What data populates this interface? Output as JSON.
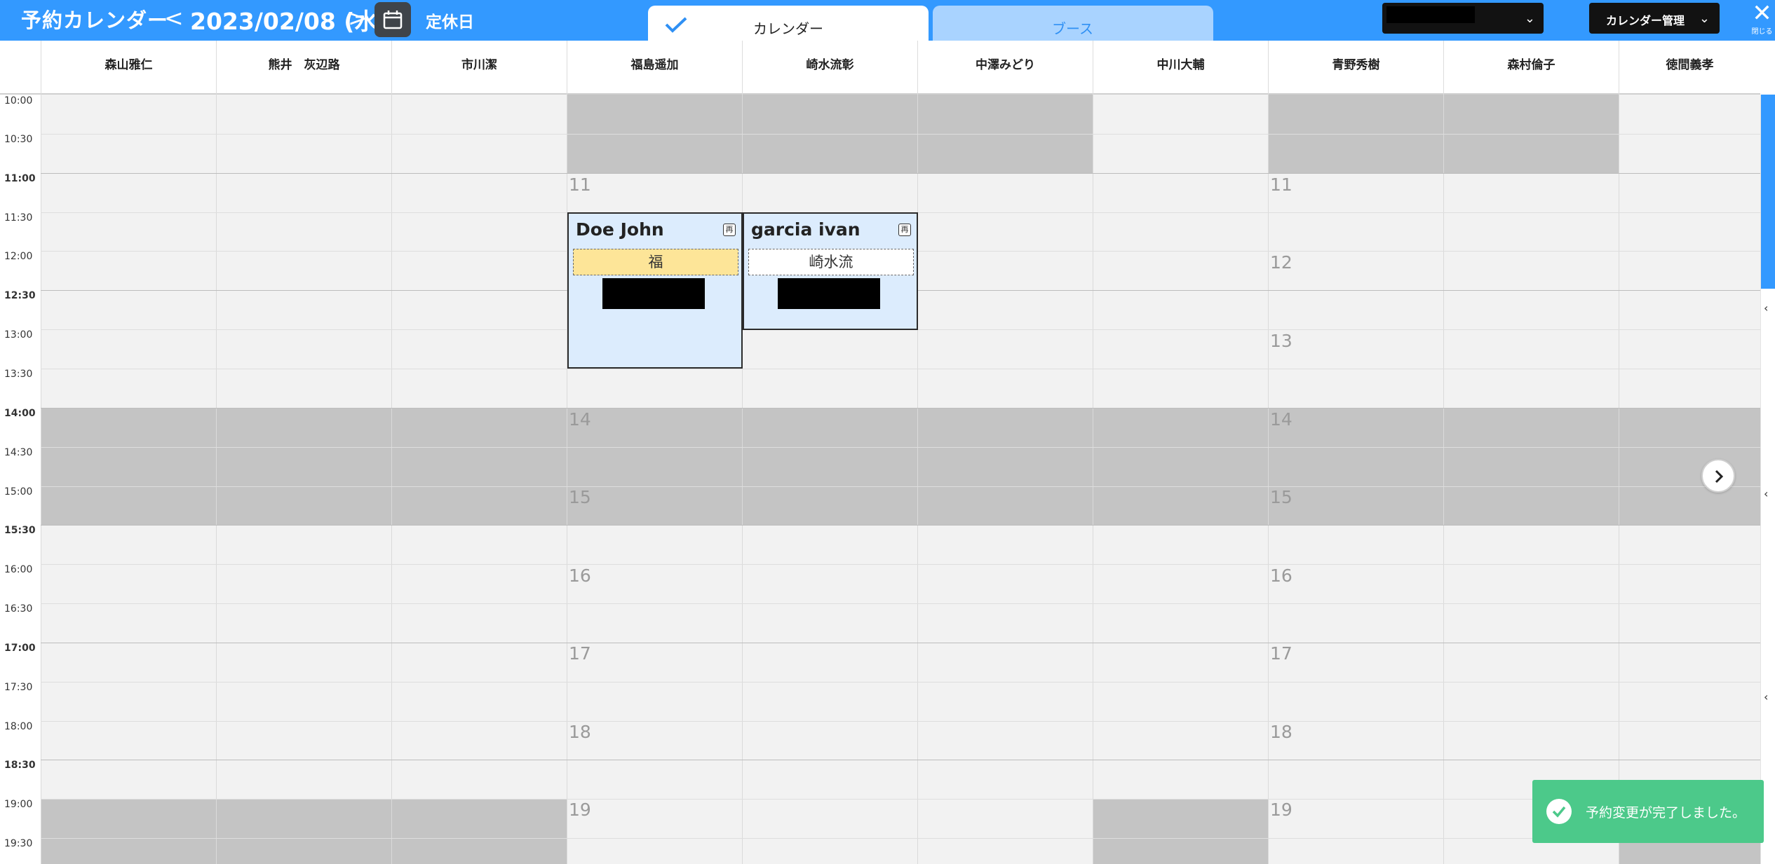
{
  "header": {
    "app_title": "予約カレンダー",
    "date_text": "2023/02/08 (水)",
    "prev_symbol": "<",
    "next_symbol": ">",
    "holiday_label": "定休日",
    "tabs": [
      {
        "label": "カレンダー",
        "active": true
      },
      {
        "label": "ブース",
        "active": false
      }
    ],
    "calendar_manage_label": "カレンダー管理",
    "close_label": "閉じる",
    "colors": {
      "primary": "#3399ff",
      "tab_inactive": "#a9d3ff",
      "dark_button": "#121212"
    }
  },
  "staff_columns": [
    "森山雅仁",
    "熊井　灰辺路",
    "市川潔",
    "福島遥加",
    "崎水流彰",
    "中澤みどり",
    "中川大輔",
    "青野秀樹",
    "森村倫子",
    "徳間義孝"
  ],
  "time_slots": [
    "10:00",
    "10:30",
    "11:00",
    "11:30",
    "12:00",
    "12:30",
    "13:00",
    "13:30",
    "14:00",
    "14:30",
    "15:00",
    "15:30",
    "16:00",
    "16:30",
    "17:00",
    "17:30",
    "18:00",
    "18:30",
    "19:00",
    "19:30"
  ],
  "hour_markers": {
    "col_4": [
      "11",
      "14",
      "15",
      "16",
      "17",
      "18",
      "19"
    ],
    "col_8": [
      "11",
      "12",
      "13",
      "14",
      "15",
      "16",
      "17",
      "18",
      "19"
    ]
  },
  "bookings": [
    {
      "name": "Doe John",
      "tag": "福",
      "tag_color": "#fde598",
      "icon": "再"
    },
    {
      "name": "garcia ivan",
      "tag": "崎水流",
      "tag_color": "#ffffff",
      "icon": "再"
    }
  ],
  "toast": {
    "message": "予約変更が完了しました。",
    "color": "#4cc98a"
  }
}
